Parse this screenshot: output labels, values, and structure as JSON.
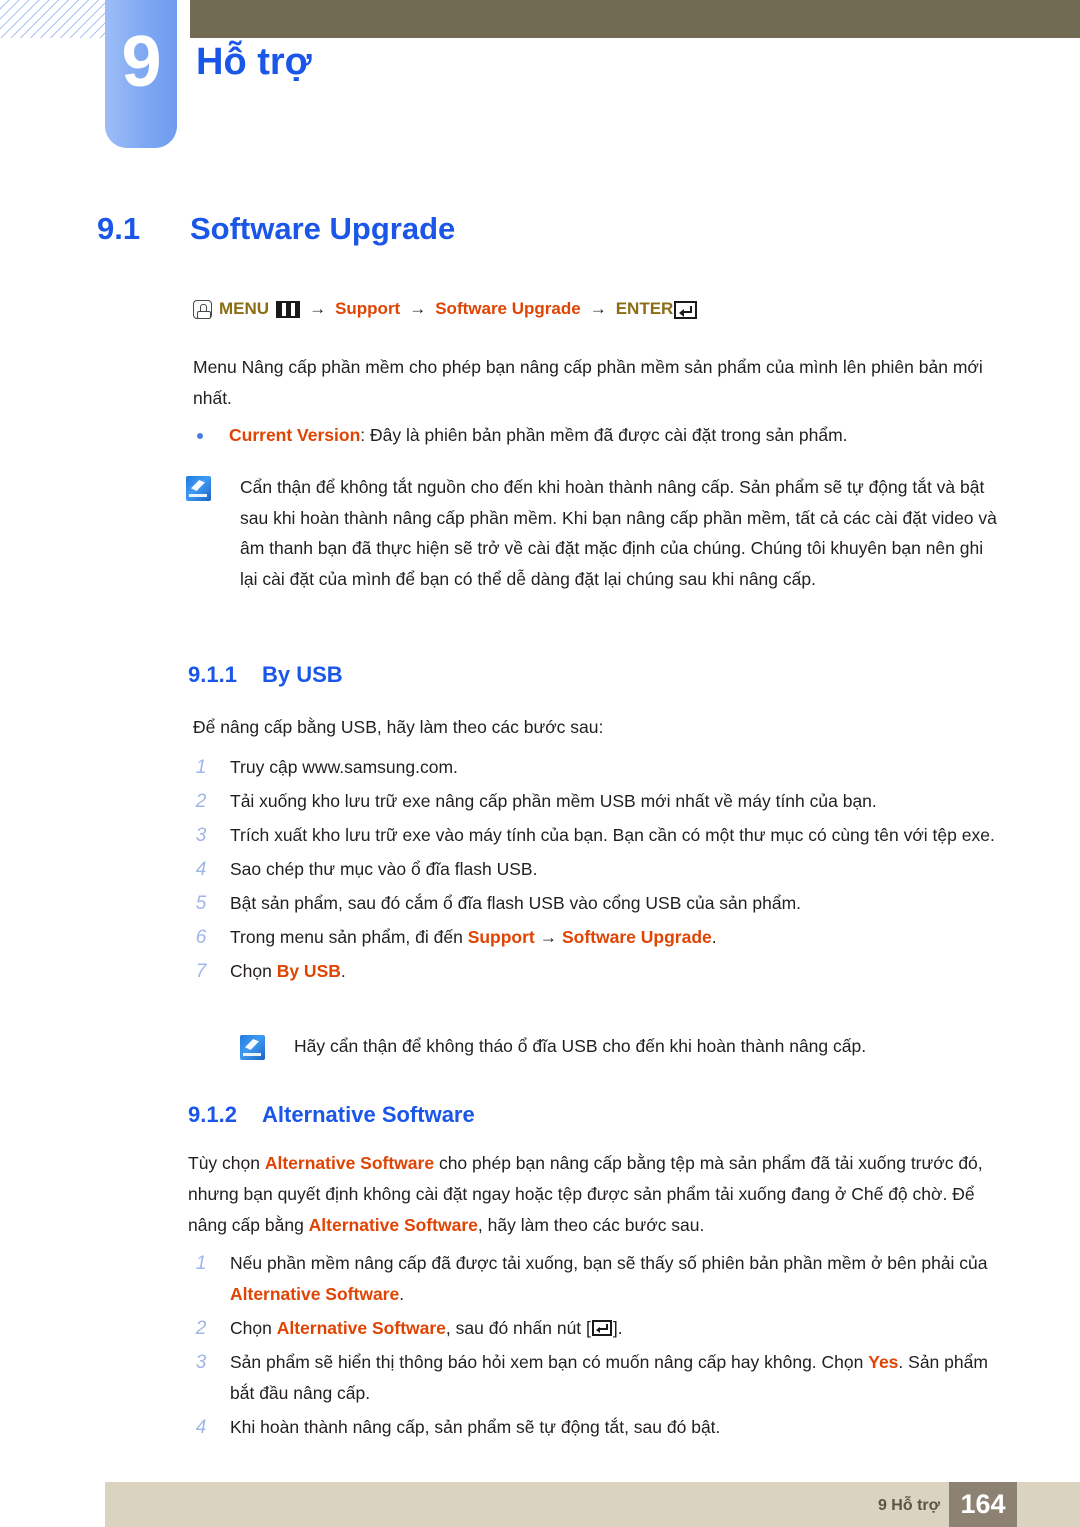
{
  "header": {
    "chapter_number": "9",
    "chapter_title": "Hỗ trợ"
  },
  "section": {
    "number": "9.1",
    "title": "Software Upgrade"
  },
  "menu_path": {
    "menu_label": "MENU",
    "arrow": "→",
    "item1": "Support",
    "item2": "Software Upgrade",
    "enter_label": "ENTER",
    "hand_icon": "hand-press-icon",
    "grid_icon": "menu-grid-icon",
    "enter_icon": "enter-key-icon",
    "colors": {
      "keyword": "#8a6d14",
      "red": "#e04403"
    }
  },
  "intro_paragraph": "Menu Nâng cấp phần mềm cho phép bạn nâng cấp phần mềm sản phẩm của mình lên phiên bản mới nhất.",
  "bullet": {
    "term": "Current Version",
    "text": ": Đây là phiên bản phần mềm đã được cài đặt trong sản phẩm."
  },
  "note1": "Cẩn thận để không tắt nguồn cho đến khi hoàn thành nâng cấp. Sản phẩm sẽ tự động tắt và bật sau khi hoàn thành nâng cấp phần mềm. Khi bạn nâng cấp phần mềm, tất cả các cài đặt video và âm thanh bạn đã thực hiện sẽ trở về cài đặt mặc định của chúng. Chúng tôi khuyên bạn nên ghi lại cài đặt của mình để bạn có thể dễ dàng đặt lại chúng sau khi nâng cấp.",
  "subsection_1": {
    "number": "9.1.1",
    "title": "By USB",
    "lead": "Để nâng cấp bằng USB, hãy làm theo các bước sau:",
    "steps": [
      {
        "n": "1",
        "text": "Truy cập www.samsung.com."
      },
      {
        "n": "2",
        "text": "Tải xuống kho lưu trữ exe nâng cấp phần mềm USB mới nhất về máy tính của bạn."
      },
      {
        "n": "3",
        "text": "Trích xuất kho lưu trữ exe vào máy tính của bạn. Bạn cần có một thư mục có cùng tên với tệp exe."
      },
      {
        "n": "4",
        "text": "Sao chép thư mục vào ổ đĩa flash USB."
      },
      {
        "n": "5",
        "text": "Bật sản phẩm, sau đó cắm ổ đĩa flash USB vào cổng USB của sản phẩm."
      },
      {
        "n": "6",
        "prefix": "Trong menu sản phẩm, đi đến ",
        "bold1": "Support",
        "mid": " → ",
        "bold2": "Software Upgrade",
        "suffix": "."
      },
      {
        "n": "7",
        "prefix": "Chọn ",
        "bold1": "By USB",
        "suffix": "."
      }
    ]
  },
  "note2": "Hãy cẩn thận để không tháo ổ đĩa USB cho đến khi hoàn thành nâng cấp.",
  "subsection_2": {
    "number": "9.1.2",
    "title": "Alternative Software",
    "lead_p1": "Tùy chọn ",
    "lead_b1": "Alternative Software",
    "lead_p2": " cho phép bạn nâng cấp bằng tệp mà sản phẩm đã tải xuống trước đó, nhưng bạn quyết định không cài đặt ngay hoặc tệp được sản phẩm tải xuống đang ở Chế độ chờ. Để nâng cấp bằng ",
    "lead_b2": "Alternative Software",
    "lead_p3": ", hãy làm theo các bước sau.",
    "steps": [
      {
        "n": "1",
        "prefix": "Nếu phần mềm nâng cấp đã được tải xuống, bạn sẽ thấy số phiên bản phần mềm ở bên phải của ",
        "bold1": "Alternative Software",
        "suffix": "."
      },
      {
        "n": "2",
        "prefix": "Chọn ",
        "bold1": "Alternative Software",
        "mid": ", sau đó nhấn nút [",
        "icon": "enter-key-icon",
        "suffix": "]."
      },
      {
        "n": "3",
        "prefix": "Sản phẩm sẽ hiển thị thông báo hỏi xem bạn có muốn nâng cấp hay không. Chọn ",
        "bold1": "Yes",
        "suffix": ". Sản phẩm bắt đầu nâng cấp."
      },
      {
        "n": "4",
        "text": "Khi hoàn thành nâng cấp, sản phẩm sẽ tự động tắt, sau đó bật."
      }
    ]
  },
  "footer": {
    "label": "9 Hỗ trợ",
    "page_number": "164"
  },
  "colors": {
    "heading_blue": "#1a56e8",
    "accent_red": "#e04403",
    "olive": "#716b54",
    "footer_bar": "#d9d3bf",
    "footer_page": "#8d8272"
  }
}
